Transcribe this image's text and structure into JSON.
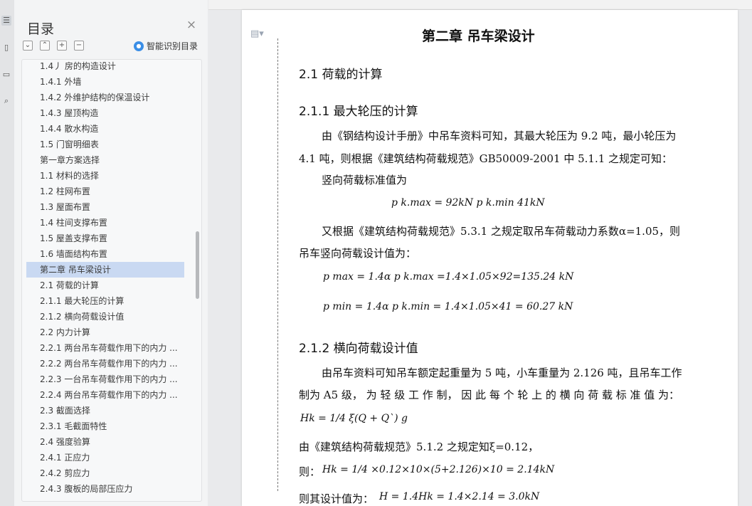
{
  "nav": {
    "title": "目录",
    "smart_toc_label": "智能识别目录",
    "items": [
      "1.4丿 房的构造设计",
      "1.4.1 外墙",
      "1.4.2 外维护结构的保温设计",
      "1.4.3 屋顶构造",
      "1.4.4 散水构造",
      "1.5 门窗明细表",
      "第一章方案选择",
      "1.1 材料的选择",
      "1.2 柱网布置",
      "1.3 屋面布置",
      "1.4 柱间支撑布置",
      "1.5 屋盖支撑布置",
      "1.6 墙面结构布置",
      "第二章  吊车梁设计",
      "2.1  荷载的计算",
      "2.1.1  最大轮压的计算",
      "2.1.2    横向荷载设计值",
      "2.2    内力计算",
      "2.2.1  两台吊车荷载作用下的内力 ...",
      "2.2.2  两台吊车荷载作用下的内力 ...",
      "2.2.3  一台吊车荷载作用下的内力 ...",
      "2.2.4  两台吊车荷载作用下的内力 ...",
      "2.3  截面选择",
      "2.3.1 毛截面特性",
      "2.4  强度验算",
      "2.4.1    正应力",
      "2.4.2    剪应力",
      "2.4.3    腹板的局部压应力"
    ],
    "active_index": 13
  },
  "doc": {
    "chapter_title": "第二章     吊车梁设计",
    "h2_1": "2.1  荷载的计算",
    "h3_1": "2.1.1  最大轮压的计算",
    "p1a": "由《钢结构设计手册》中吊车资料可知，其最大轮压为 9.2 吨，最小轮压为",
    "p1b": "4.1 吨，则根据《建筑结构荷载规范》GB50009-2001 中 5.1.1 之规定可知：",
    "p2": "竖向荷载标准值为",
    "eq1": "p k.max = 92kN      p k.min 41kN",
    "p3a": "又根据《建筑结构荷载规范》5.3.1 之规定取吊车荷载动力系数α=1.05，则",
    "p3b": "吊车竖向荷载设计值为：",
    "eq2": "p max = 1.4α p k.max =1.4×1.05×92=135.24 kN",
    "eq3": "p min = 1.4α p k.min = 1.4×1.05×41 = 60.27 kN",
    "h3_2": "2.1.2   横向荷载设计值",
    "p4a": "由吊车资料可知吊车额定起重量为 5 吨，小车重量为 2.126 吨，且吊车工作",
    "p4b": "制为  A5 级， 为 轻 级 工 作 制， 因 此 每 个 轮 上 的 横 向 荷 载 标 准 值 为：",
    "eq4": "Hk = 1/4 ξ(Q + Q`) g",
    "p5": "由《建筑结构荷载规范》5.1.2 之规定知ξ=0.12，",
    "p6_label": "则：",
    "eq5": "Hk = 1/4 ×0.12×10×(5+2.126)×10 = 2.14kN",
    "p7_label": "则其设计值为：",
    "eq6": "H = 1.4Hk = 1.4×2.14 = 3.0kN"
  }
}
